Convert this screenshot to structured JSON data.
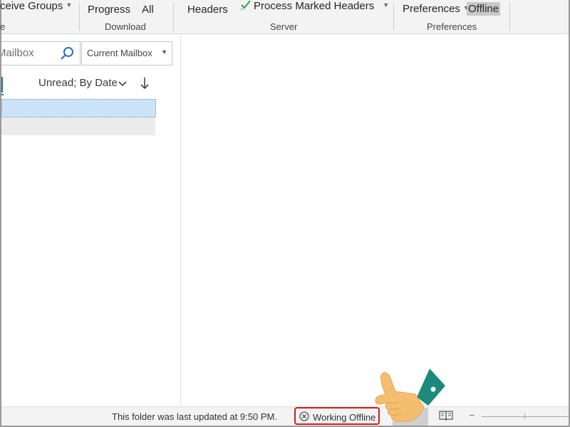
{
  "ribbon": {
    "receive_groups": "ceive Groups",
    "progress": "Progress",
    "all": "All",
    "download_label": "Download",
    "headers": "Headers",
    "process_marked_headers": "Process Marked Headers",
    "server_label": "Server",
    "preferences": "Preferences",
    "offline": "Offline",
    "preferences_label": "Preferences",
    "edge_label": "e"
  },
  "search": {
    "placeholder": "Mailbox",
    "scope": "Current Mailbox"
  },
  "list": {
    "sort": "Unread; By Date"
  },
  "status": {
    "last_updated": "This folder was last updated at 9:50 PM.",
    "working_offline": "Working Offline"
  },
  "colors": {
    "accent": "#2e6fba",
    "selected_row": "#cce4f7",
    "offline_highlight": "#cc1f1f"
  }
}
